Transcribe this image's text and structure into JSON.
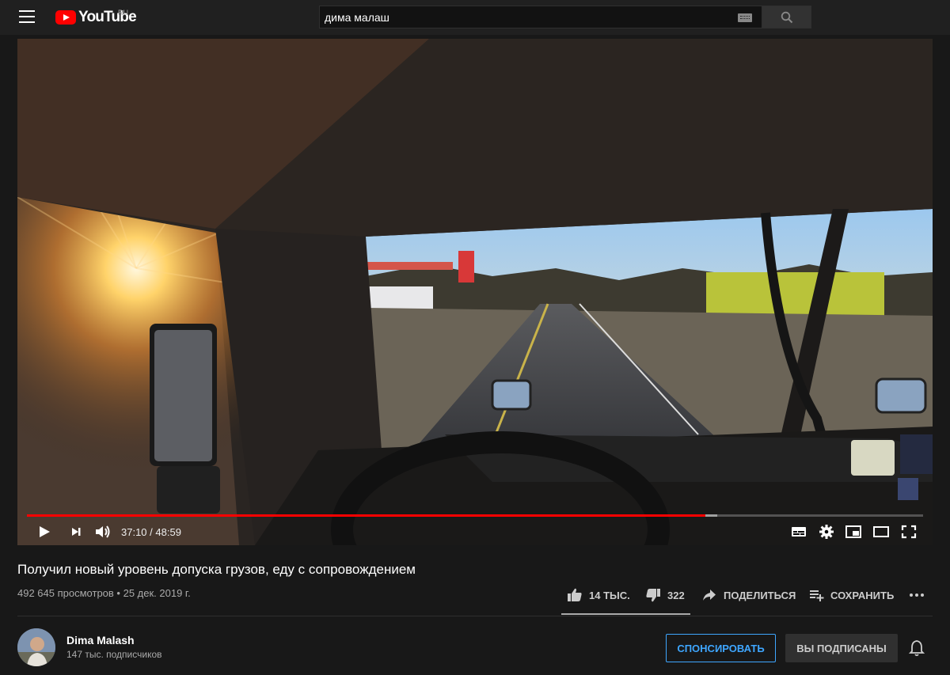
{
  "header": {
    "logo_text": "YouTube",
    "logo_country": "RU",
    "search_value": "дима малаш"
  },
  "player": {
    "current_time": "37:10",
    "duration": "48:59",
    "time_separator": " / ",
    "progress_played": 0.757,
    "progress_loaded": 0.77
  },
  "video": {
    "title": "Получил новый уровень допуска грузов, еду с сопровождением",
    "views": "492 645 просмотров",
    "date_separator": " • ",
    "date": "25 дек. 2019 г.",
    "likes": "14 ТЫС.",
    "dislikes": "322",
    "share_label": "ПОДЕЛИТЬСЯ",
    "save_label": "СОХРАНИТЬ",
    "like_ratio": 0.978
  },
  "channel": {
    "name": "Dima Malash",
    "subscribers": "147 тыс. подписчиков",
    "sponsor_label": "СПОНСИРОВАТЬ",
    "subscribed_label": "ВЫ ПОДПИСАНЫ"
  },
  "colors": {
    "accent_red": "#ff0000",
    "link_blue": "#3ea6ff",
    "background": "#181818"
  }
}
